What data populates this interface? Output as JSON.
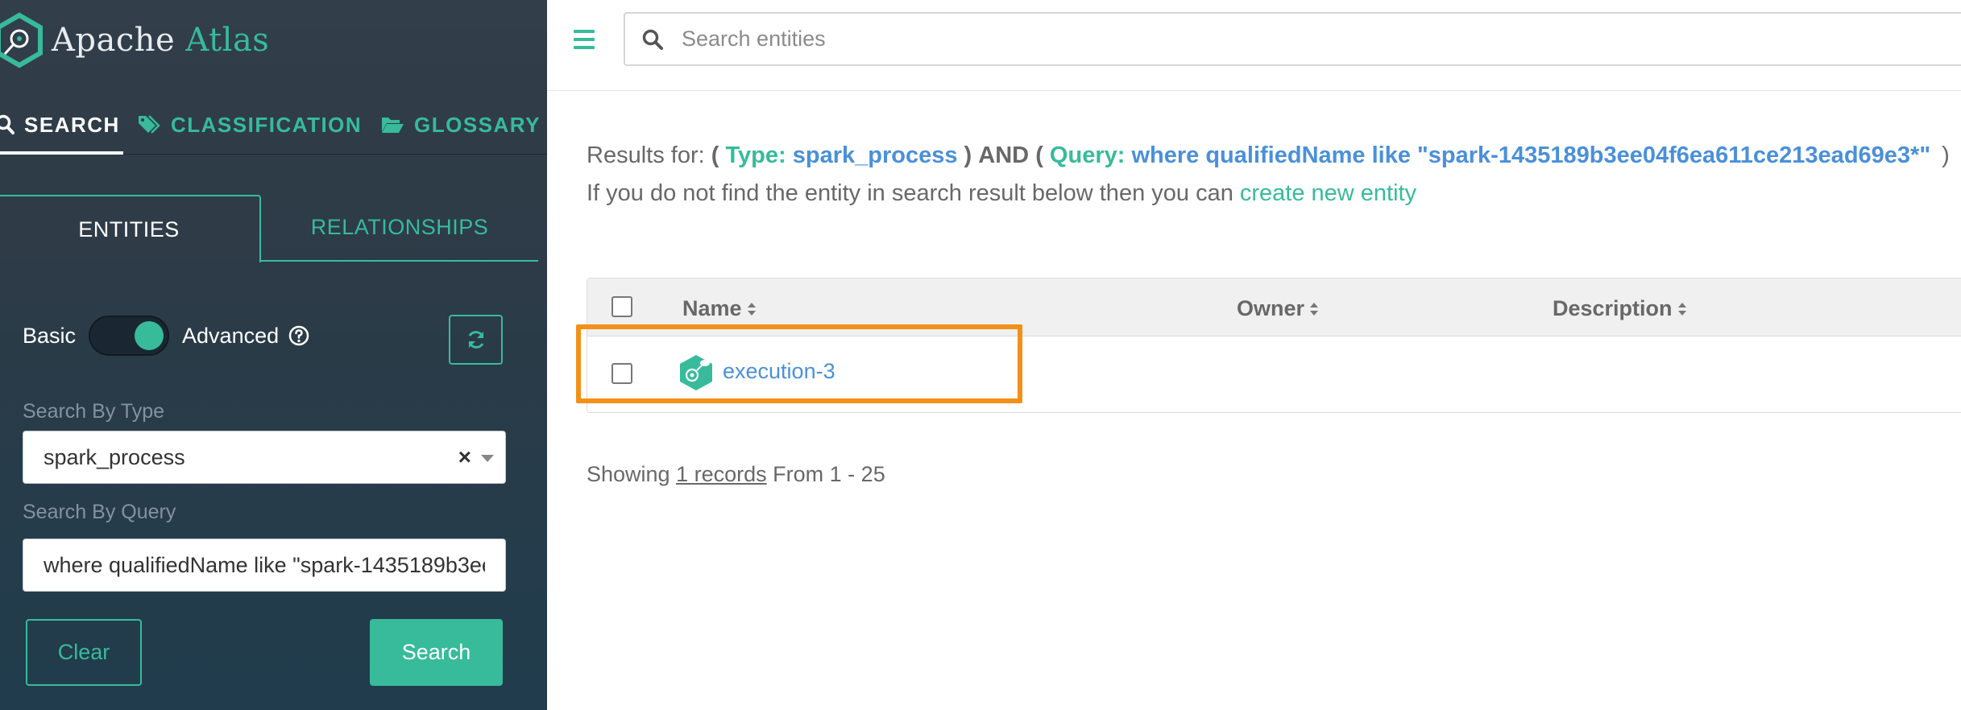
{
  "app": {
    "name_part1": "Apache",
    "name_part2": "Atlas"
  },
  "nav": {
    "tabs": [
      {
        "label": "SEARCH",
        "icon": "search-icon",
        "active": true
      },
      {
        "label": "CLASSIFICATION",
        "icon": "tag-icon",
        "active": false
      },
      {
        "label": "GLOSSARY",
        "icon": "folder-open-icon",
        "active": false
      }
    ]
  },
  "sub_tabs": {
    "entities": "ENTITIES",
    "relationships": "RELATIONSHIPS"
  },
  "mode": {
    "basic": "Basic",
    "advanced": "Advanced",
    "advanced_enabled": true
  },
  "filters": {
    "type_label": "Search By Type",
    "type_value": "spark_process",
    "type_clear": "×",
    "query_label": "Search By Query",
    "query_value": "where qualifiedName like \"spark-1435189b3ee04f6ea611ce213ead69e3*\""
  },
  "buttons": {
    "clear": "Clear",
    "search": "Search"
  },
  "topbar": {
    "search_placeholder": "Search entities"
  },
  "results": {
    "prefix": "Results for:",
    "paren_open": "(",
    "type_key": "Type:",
    "type_value": "spark_process",
    "paren_close": ")",
    "and": "AND",
    "query_key": "Query:",
    "query_value": "where qualifiedName like \"spark-1435189b3ee04f6ea611ce213ead69e3*\"",
    "info_text": "If you do not find the entity in search result below then you can",
    "create_link": "create new entity"
  },
  "table": {
    "columns": [
      "Name",
      "Owner",
      "Description"
    ],
    "rows": [
      {
        "name": "execution-3",
        "owner": "",
        "description": ""
      }
    ]
  },
  "pagination": {
    "prefix": "Showing",
    "records": "1 records",
    "range": "From 1 - 25"
  },
  "colors": {
    "accent": "#37bb9b",
    "link": "#4a90d9",
    "highlight": "#f39018"
  }
}
